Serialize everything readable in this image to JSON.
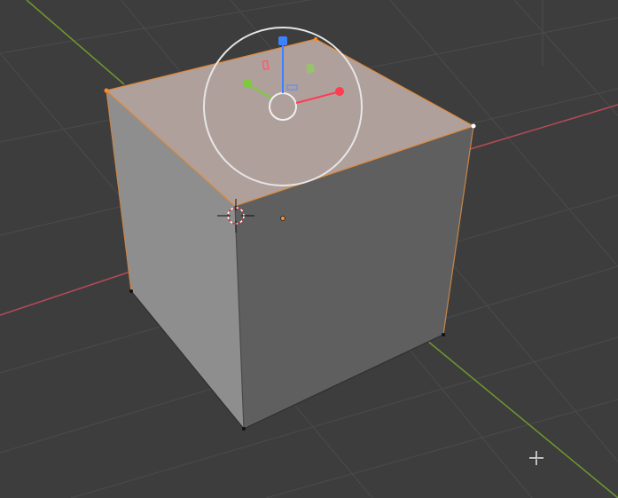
{
  "viewport": {
    "background": "#3d3d3d",
    "grid_color": "#4d4d4d",
    "x_axis_color": "#b84a56",
    "y_axis_color": "#6f9a2c"
  },
  "mesh": {
    "object": "cube",
    "mode": "edit-mode",
    "select_mode": "face",
    "selected_face": "top",
    "face_colors": {
      "top_selected": "#b0a09c",
      "left": "#8f8f8f",
      "front": "#5f5f5f",
      "selected_edge": "#e08a3a",
      "vertex": "#000000",
      "active_vertex": "#ffffff"
    }
  },
  "gizmo": {
    "type": "transform-gizmo",
    "x_color": "#ff3c52",
    "y_color": "#7ccc3a",
    "z_color": "#3c82ff",
    "ring_color": "#e6e6e6"
  },
  "cursor_3d": {
    "name": "3d-cursor"
  },
  "pointer": {
    "name": "crosshair-pointer"
  }
}
